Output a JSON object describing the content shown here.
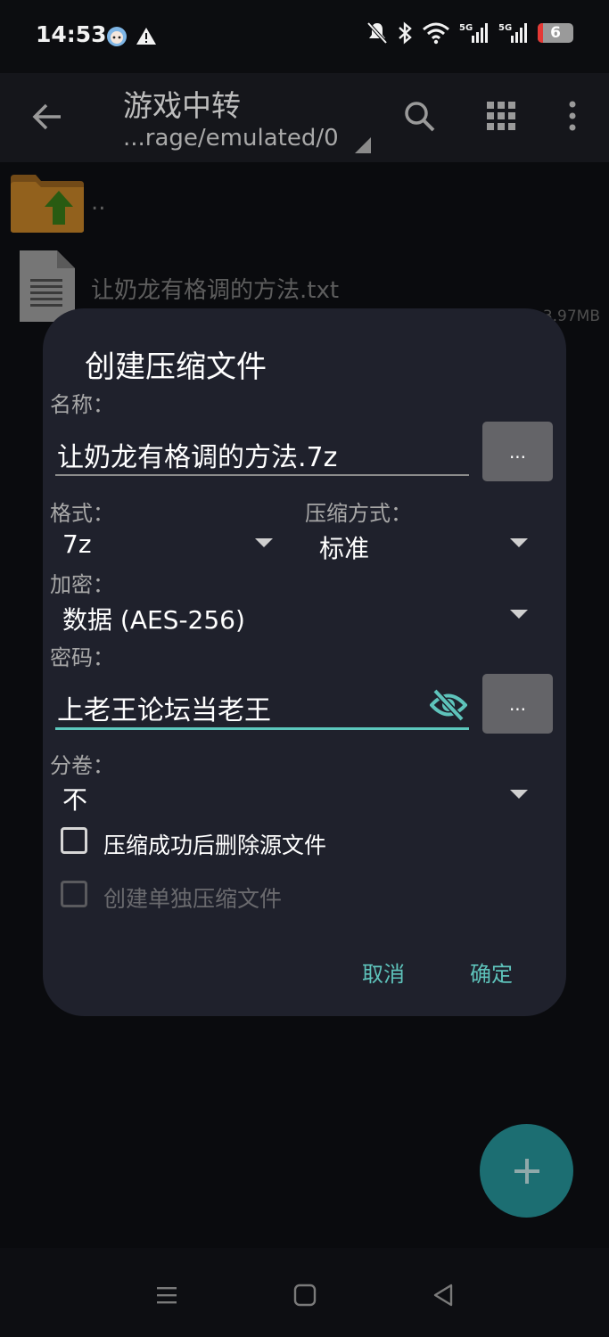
{
  "status_bar": {
    "time": "14:53",
    "battery_level": "6",
    "network_labels": [
      "5G",
      "5G"
    ]
  },
  "app_bar": {
    "title": "游戏中转",
    "path": "...rage/emulated/0"
  },
  "file_list": [
    {
      "name": "..",
      "type": "parent-folder"
    },
    {
      "name": "让奶龙有格调的方法.txt",
      "size": "3.97MB",
      "type": "text-file"
    }
  ],
  "dialog": {
    "title": "创建压缩文件",
    "name_label": "名称：",
    "name_value": "让奶龙有格调的方法.7z",
    "more_button": "...",
    "format_label": "格式：",
    "format_value": "7z",
    "method_label": "压缩方式：",
    "method_value": "标准",
    "encryption_label": "加密：",
    "encryption_value": "数据 (AES-256)",
    "password_label": "密码：",
    "password_value": "上老王论坛当老王",
    "split_label": "分卷：",
    "split_value": "不",
    "delete_source_label": "压缩成功后删除源文件",
    "separate_archive_label": "创建单独压缩文件",
    "cancel_label": "取消",
    "confirm_label": "确定"
  },
  "colors": {
    "accent": "#5ec3bb",
    "dialog_bg": "#1f212c",
    "fab_bg": "#1c6e72",
    "folder": "#e0952d",
    "folder_arrow": "#3f8c1d"
  }
}
